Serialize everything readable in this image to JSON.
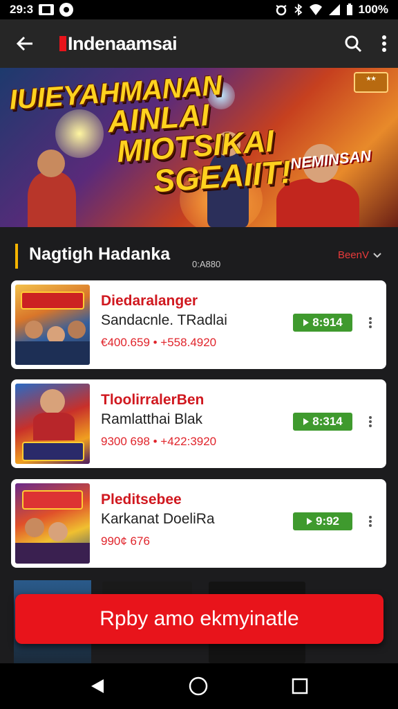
{
  "status_bar": {
    "time": "29:3",
    "battery": "100%"
  },
  "app_bar": {
    "title": "Indenaamsai",
    "back_icon": "arrow-left-icon",
    "search_icon": "search-icon",
    "menu_icon": "more-vertical-icon"
  },
  "banner": {
    "headline_lines": [
      "IUIEYAHMANAN",
      "AINLAI",
      "MIOTSIKAI",
      "SGEAIIT!"
    ],
    "tag": "NEMINSAN"
  },
  "section": {
    "title": "Nagtigh Hadanka",
    "count": "0:A880",
    "sort_label": "BeenV"
  },
  "list": [
    {
      "name": "Diedaralanger",
      "subtitle": "Sandacnle. TRadlai",
      "meta": "€400.659 • +558.4920",
      "price": "8:914",
      "price_icon": "play-icon"
    },
    {
      "name": "TloolirralerBen",
      "subtitle": "Ramlatthai Blak",
      "meta": "9300 698 • +422:3920",
      "price": "8:314",
      "price_icon": "play-icon"
    },
    {
      "name": "Pleditsebee",
      "subtitle": "Karkanat DoeliRa",
      "meta": "990¢ 676",
      "price": "9:92",
      "price_icon": "play-icon"
    }
  ],
  "cta": {
    "label": "Rpby amo ekmyinatle"
  },
  "nav_bar": {
    "back_icon": "triangle-back-icon",
    "home_icon": "circle-home-icon",
    "recents_icon": "square-recents-icon"
  },
  "colors": {
    "accent_red": "#e8141b",
    "price_green": "#3f9a2e",
    "section_bar": "#f5b400"
  }
}
